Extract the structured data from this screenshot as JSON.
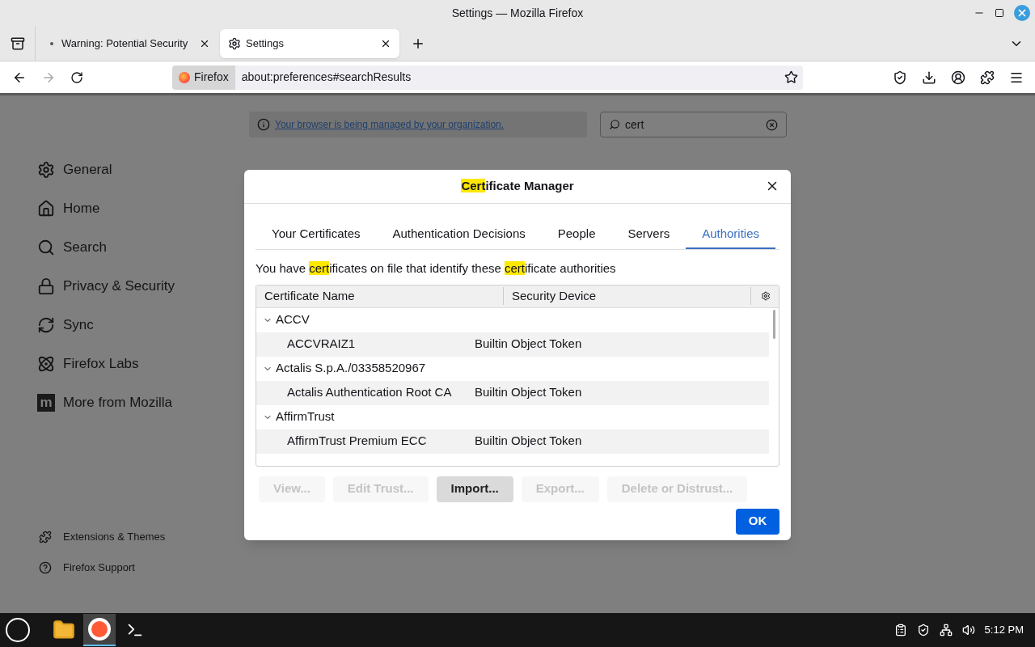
{
  "window": {
    "title": "Settings — Mozilla Firefox"
  },
  "tabs": [
    {
      "label": "Warning: Potential Security",
      "selected": false,
      "kind": "dot"
    },
    {
      "label": "Settings",
      "selected": true,
      "kind": "gear"
    }
  ],
  "address": {
    "identity": "Firefox",
    "url": "about:preferences#searchResults"
  },
  "notice": {
    "link": "Your browser is being managed by your organization."
  },
  "search": {
    "value": "cert"
  },
  "sidebar": {
    "items": [
      {
        "label": "General",
        "kind": "gear"
      },
      {
        "label": "Home",
        "kind": "home"
      },
      {
        "label": "Search",
        "kind": "search"
      },
      {
        "label": "Privacy & Security",
        "kind": "lock"
      },
      {
        "label": "Sync",
        "kind": "sync"
      },
      {
        "label": "Firefox Labs",
        "kind": "labs"
      },
      {
        "label": "More from Mozilla",
        "kind": "logo",
        "logo_text": "m"
      }
    ],
    "footer": [
      {
        "label": "Extensions & Themes",
        "kind": "puzzle"
      },
      {
        "label": "Firefox Support",
        "kind": "help"
      }
    ]
  },
  "dialog": {
    "title": [
      {
        "text": "Cert",
        "highlight": true
      },
      {
        "text": "ificate Manager",
        "highlight": false
      }
    ],
    "tabs": [
      {
        "label": "Your Certificates",
        "selected": false
      },
      {
        "label": "Authentication Decisions",
        "selected": false
      },
      {
        "label": "People",
        "selected": false
      },
      {
        "label": "Servers",
        "selected": false
      },
      {
        "label": "Authorities",
        "selected": true
      }
    ],
    "description": [
      {
        "text": "You have ",
        "highlight": false
      },
      {
        "text": "cert",
        "highlight": true
      },
      {
        "text": "ificates on file that identify these ",
        "highlight": false
      },
      {
        "text": "cert",
        "highlight": true
      },
      {
        "text": "ificate authorities",
        "highlight": false
      }
    ],
    "columns": [
      "Certificate Name",
      "Security Device"
    ],
    "groups": [
      {
        "name": "ACCV",
        "expanded": true,
        "children": [
          {
            "name": "ACCVRAIZ1",
            "device": "Builtin Object Token"
          }
        ]
      },
      {
        "name": "Actalis S.p.A./03358520967",
        "expanded": true,
        "children": [
          {
            "name": "Actalis Authentication Root CA",
            "device": "Builtin Object Token"
          }
        ]
      },
      {
        "name": "AffirmTrust",
        "expanded": true,
        "children": [
          {
            "name": "AffirmTrust Premium ECC",
            "device": "Builtin Object Token"
          }
        ]
      }
    ],
    "buttons": [
      {
        "label": "View...",
        "disabled": true
      },
      {
        "label": "Edit Trust...",
        "disabled": true
      },
      {
        "label": "Import...",
        "disabled": false
      },
      {
        "label": "Export...",
        "disabled": true
      },
      {
        "label": "Delete or Distrust...",
        "disabled": true
      }
    ],
    "ok": "OK"
  },
  "taskbar": {
    "clock": "5:12 PM"
  }
}
